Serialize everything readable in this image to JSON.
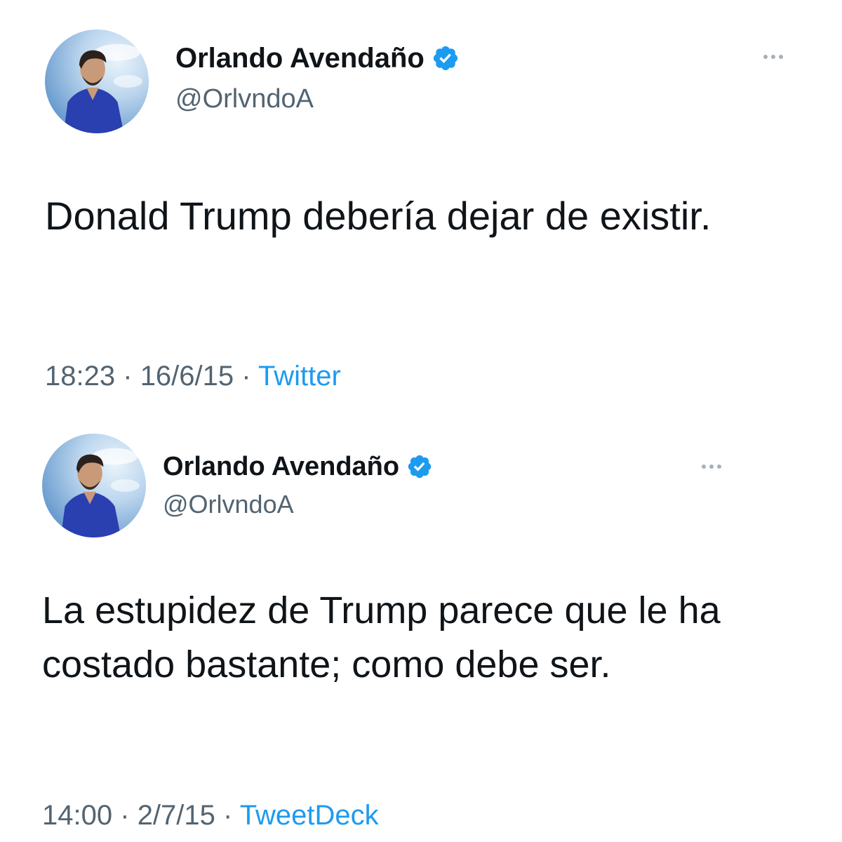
{
  "colors": {
    "text": "#0f1419",
    "secondary_text": "#536471",
    "link": "#1d9bf0",
    "verified_badge": "#1d9bf0",
    "more_dots": "#a7b0b8",
    "background": "#ffffff"
  },
  "tweets": [
    {
      "author": {
        "display_name": "Orlando Avendaño",
        "handle": "@OrlvndoA",
        "verified_icon": "verified-badge-icon",
        "avatar": "profile-photo"
      },
      "more_icon": "more-options-icon",
      "text": "Donald Trump debería dejar de existir.",
      "time": "18:23",
      "date": "16/6/15",
      "separator": "·",
      "source": "Twitter"
    },
    {
      "author": {
        "display_name": "Orlando Avendaño",
        "handle": "@OrlvndoA",
        "verified_icon": "verified-badge-icon",
        "avatar": "profile-photo"
      },
      "more_icon": "more-options-icon",
      "text": "La estupidez de Trump parece que le ha costado bastante; como debe ser.",
      "time": "14:00",
      "date": "2/7/15",
      "separator": "·",
      "source": "TweetDeck"
    }
  ]
}
